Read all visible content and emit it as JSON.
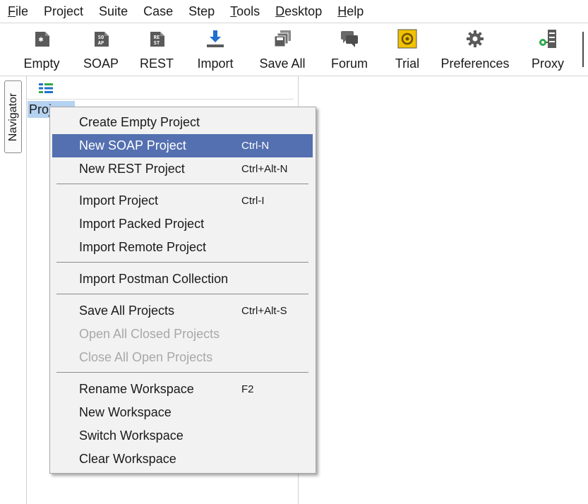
{
  "menubar": [
    {
      "pre": "",
      "u": "F",
      "post": "ile"
    },
    {
      "pre": "",
      "u": "",
      "post": "Project"
    },
    {
      "pre": "",
      "u": "",
      "post": "Suite"
    },
    {
      "pre": "",
      "u": "",
      "post": "Case"
    },
    {
      "pre": "",
      "u": "",
      "post": "Step"
    },
    {
      "pre": "",
      "u": "T",
      "post": "ools"
    },
    {
      "pre": "",
      "u": "D",
      "post": "esktop"
    },
    {
      "pre": "",
      "u": "H",
      "post": "elp"
    }
  ],
  "toolbar": {
    "empty": "Empty",
    "soap": "SOAP",
    "rest": "REST",
    "import": "Import",
    "save_all": "Save All",
    "forum": "Forum",
    "trial": "Trial",
    "preferences": "Preferences",
    "proxy": "Proxy",
    "soap_icon_text": "SO AP",
    "rest_icon_text": "RE ST"
  },
  "navigator": {
    "label": "Navigator"
  },
  "tree": {
    "root_label": "Proj"
  },
  "context_menu": {
    "items": [
      {
        "label": "Create Empty Project",
        "shortcut": ""
      },
      {
        "label": "New SOAP Project",
        "shortcut": "Ctrl-N"
      },
      {
        "label": "New REST Project",
        "shortcut": "Ctrl+Alt-N"
      },
      {
        "label": "Import Project",
        "shortcut": "Ctrl-I"
      },
      {
        "label": "Import Packed Project",
        "shortcut": ""
      },
      {
        "label": "Import Remote Project",
        "shortcut": ""
      },
      {
        "label": "Import Postman Collection",
        "shortcut": ""
      },
      {
        "label": "Save All Projects",
        "shortcut": "Ctrl+Alt-S"
      },
      {
        "label": "Open All Closed Projects",
        "shortcut": ""
      },
      {
        "label": "Close All Open Projects",
        "shortcut": ""
      },
      {
        "label": "Rename Workspace",
        "shortcut": "F2"
      },
      {
        "label": "New Workspace",
        "shortcut": ""
      },
      {
        "label": "Switch Workspace",
        "shortcut": ""
      },
      {
        "label": "Clear Workspace",
        "shortcut": ""
      }
    ]
  },
  "colors": {
    "highlight": "#5470b0",
    "disabled": "#a8a8a8",
    "icon_dark": "#5a5a5a",
    "import_blue": "#1f6fcf",
    "trial_yellow": "#f2c200",
    "proxy_green": "#2ea84a"
  }
}
